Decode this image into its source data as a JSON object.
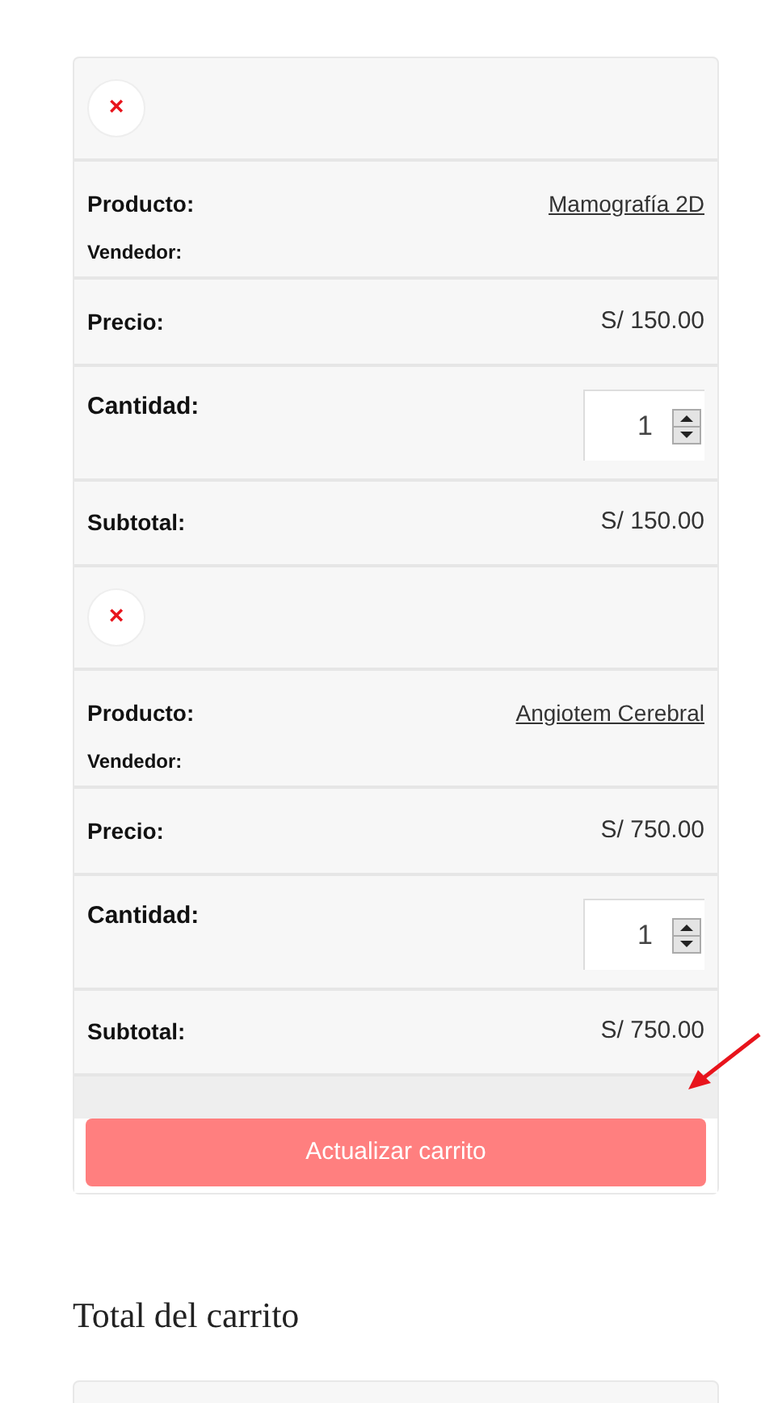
{
  "cart_items": [
    {
      "remove": "×",
      "product_label": "Producto:",
      "product": "Mamografía 2D",
      "vendor_label": "Vendedor:",
      "price_label": "Precio:",
      "price": "S/ 150.00",
      "quantity_label": "Cantidad:",
      "quantity": "1",
      "subtotal_label": "Subtotal:",
      "subtotal": "S/ 150.00"
    },
    {
      "remove": "×",
      "product_label": "Producto:",
      "product": "Angiotem Cerebral",
      "vendor_label": "Vendedor:",
      "price_label": "Precio:",
      "price": "S/ 750.00",
      "quantity_label": "Cantidad:",
      "quantity": "1",
      "subtotal_label": "Subtotal:",
      "subtotal": "S/ 750.00"
    }
  ],
  "update_button": {
    "label": "Actualizar carrito",
    "disabled": true
  },
  "totals": {
    "title": "Total del carrito"
  }
}
